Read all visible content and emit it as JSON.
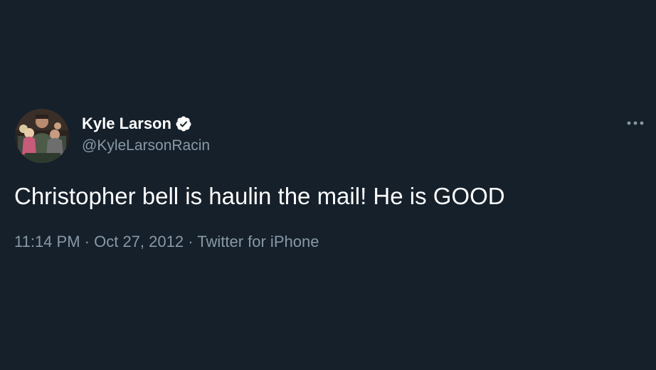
{
  "tweet": {
    "author": {
      "display_name": "Kyle Larson",
      "handle": "@KyleLarsonRacin",
      "verified": true,
      "avatar_icon": "family-photo-avatar"
    },
    "text": "Christopher bell is haulin the mail! He is GOOD",
    "meta": {
      "time": "11:14 PM",
      "separator_1": " · ",
      "date": "Oct 27, 2012",
      "separator_2": " · ",
      "source": "Twitter for iPhone"
    },
    "more_icon": "more-options-icon"
  },
  "colors": {
    "background": "#15202b",
    "primary_text": "#ffffff",
    "secondary_text": "#8899a6",
    "verified_badge": "#ffffff"
  }
}
